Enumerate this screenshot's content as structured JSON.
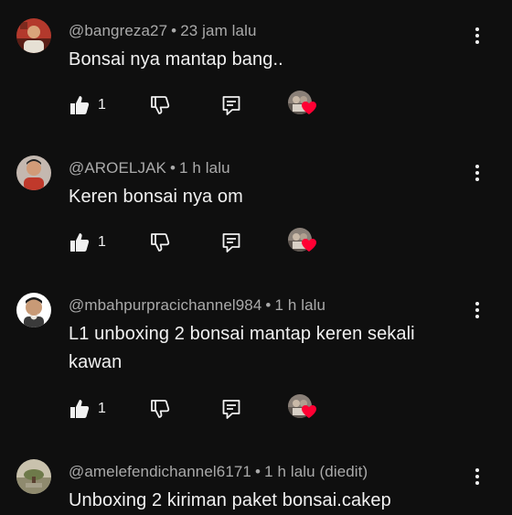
{
  "comments": [
    {
      "author": "@bangreza27",
      "time": "23 jam lalu",
      "text": "Bonsai nya mantap bang..",
      "likes": "1",
      "hearted": true
    },
    {
      "author": "@AROELJAK",
      "time": "1 h lalu",
      "text": "Keren bonsai nya om",
      "likes": "1",
      "hearted": true
    },
    {
      "author": "@mbahpurpracichannel984",
      "time": "1 h lalu",
      "text": "L1 unboxing 2 bonsai mantap keren sekali kawan",
      "likes": "1",
      "hearted": true
    },
    {
      "author": "@amelefendichannel6171",
      "time": "1 h lalu (diedit)",
      "text": "Unboxing 2 kiriman paket bonsai.cakep"
    }
  ],
  "separator": "•",
  "icons": {
    "like": "thumbs-up-icon",
    "dislike": "thumbs-down-icon",
    "reply": "reply-icon",
    "menu": "more-vertical-icon",
    "heart": "creator-heart-icon"
  },
  "colors": {
    "background": "#0f0f0f",
    "text": "#f1f1f1",
    "secondary_text": "#aaaaaa",
    "heart": "#ff0033"
  }
}
